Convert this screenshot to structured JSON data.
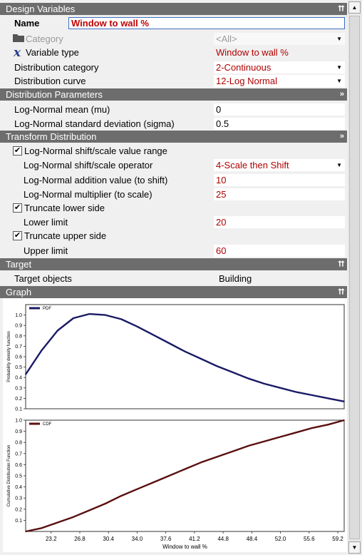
{
  "sections": {
    "design_variables": "Design Variables",
    "distribution_parameters": "Distribution Parameters",
    "transform_distribution": "Transform Distribution",
    "target": "Target",
    "graph": "Graph"
  },
  "name": {
    "label": "Name",
    "value": "Window to wall %"
  },
  "category": {
    "label": "Category",
    "value": "<All>"
  },
  "variable_type": {
    "label": "Variable type",
    "value": "Window to wall %"
  },
  "distribution_category": {
    "label": "Distribution category",
    "value": "2-Continuous"
  },
  "distribution_curve": {
    "label": "Distribution curve",
    "value": "12-Log Normal"
  },
  "mean": {
    "label": "Log-Normal mean (mu)",
    "value": "0"
  },
  "sigma": {
    "label": "Log-Normal standard deviation (sigma)",
    "value": "0.5"
  },
  "shift_scale": {
    "label": "Log-Normal shift/scale value range",
    "checked": true
  },
  "operator": {
    "label": "Log-Normal shift/scale operator",
    "value": "4-Scale then Shift"
  },
  "addition": {
    "label": "Log-Normal addition value (to shift)",
    "value": "10"
  },
  "multiplier": {
    "label": "Log-Normal multiplier (to scale)",
    "value": "25"
  },
  "truncate_lower": {
    "label": "Truncate lower side",
    "checked": true
  },
  "lower_limit": {
    "label": "Lower limit",
    "value": "20"
  },
  "truncate_upper": {
    "label": "Truncate upper side",
    "checked": true
  },
  "upper_limit": {
    "label": "Upper limit",
    "value": "60"
  },
  "target_objects": {
    "label": "Target objects",
    "value": "Building"
  },
  "icons": {
    "collapse": "chevron-up-icon",
    "folder": "folder-icon",
    "variable": "variable-x-icon"
  },
  "colors": {
    "header": "#6d6d6d",
    "value_text": "#b00000",
    "pdf_line": "#1a1a66",
    "cdf_line": "#5a0f0f"
  },
  "chart_data": [
    {
      "type": "line",
      "xlabel": "",
      "ylabel": "Probability density function",
      "legend": "PDF",
      "xlim": [
        20,
        60
      ],
      "ylim": [
        0.1,
        1.1
      ],
      "yticks": [
        "0.1",
        "0.2",
        "0.3",
        "0.4",
        "0.5",
        "0.6",
        "0.7",
        "0.8",
        "0.9",
        "1.0"
      ],
      "x": [
        20,
        22,
        24,
        26,
        28,
        30,
        32,
        34,
        36,
        38,
        40,
        42,
        44,
        46,
        48,
        50,
        52,
        54,
        56,
        58,
        60
      ],
      "y": [
        0.43,
        0.66,
        0.85,
        0.97,
        1.01,
        1.0,
        0.96,
        0.89,
        0.81,
        0.73,
        0.65,
        0.58,
        0.51,
        0.45,
        0.39,
        0.34,
        0.3,
        0.26,
        0.23,
        0.2,
        0.17
      ]
    },
    {
      "type": "line",
      "xlabel": "Window to wall %",
      "ylabel": "Cumulative Distribution Function",
      "legend": "CDF",
      "xlim": [
        20,
        60
      ],
      "ylim": [
        0,
        1.0
      ],
      "yticks": [
        "0.1",
        "0.2",
        "0.3",
        "0.4",
        "0.5",
        "0.6",
        "0.7",
        "0.8",
        "0.9",
        "1.0"
      ],
      "xticks": [
        "23.2",
        "26.8",
        "30.4",
        "34.0",
        "37.6",
        "41.2",
        "44.8",
        "48.4",
        "52.0",
        "55.6",
        "59.2"
      ],
      "x": [
        20,
        22,
        24,
        26,
        28,
        30,
        32,
        34,
        36,
        38,
        40,
        42,
        44,
        46,
        48,
        50,
        52,
        54,
        56,
        58,
        60
      ],
      "y": [
        0.0,
        0.03,
        0.08,
        0.13,
        0.19,
        0.25,
        0.32,
        0.38,
        0.44,
        0.5,
        0.56,
        0.62,
        0.67,
        0.72,
        0.77,
        0.81,
        0.85,
        0.89,
        0.93,
        0.96,
        1.0
      ]
    }
  ]
}
